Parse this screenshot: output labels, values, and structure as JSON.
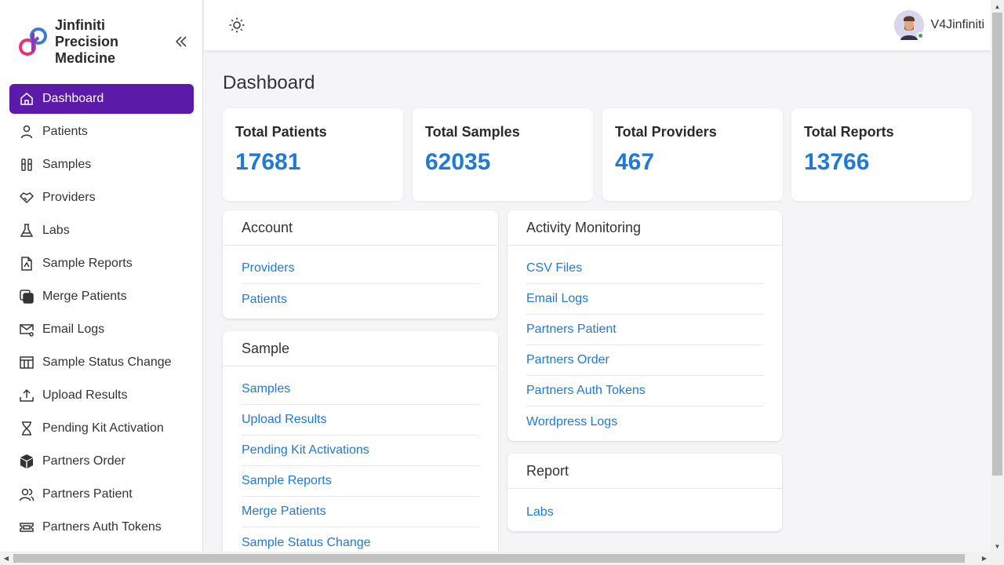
{
  "brand": {
    "name": "Jinfiniti Precision Medicine"
  },
  "sidebar": {
    "items": [
      {
        "label": "Dashboard",
        "icon": "home-icon",
        "active": true
      },
      {
        "label": "Patients",
        "icon": "user-icon"
      },
      {
        "label": "Samples",
        "icon": "test-tubes-icon"
      },
      {
        "label": "Providers",
        "icon": "handshake-icon"
      },
      {
        "label": "Labs",
        "icon": "flask-icon"
      },
      {
        "label": "Sample Reports",
        "icon": "pdf-report-icon"
      },
      {
        "label": "Merge Patients",
        "icon": "merge-icon"
      },
      {
        "label": "Email Logs",
        "icon": "mail-settings-icon"
      },
      {
        "label": "Sample Status Change",
        "icon": "table-icon"
      },
      {
        "label": "Upload Results",
        "icon": "upload-icon"
      },
      {
        "label": "Pending Kit Activation",
        "icon": "hourglass-icon"
      },
      {
        "label": "Partners Order",
        "icon": "box-icon"
      },
      {
        "label": "Partners Patient",
        "icon": "users-icon"
      },
      {
        "label": "Partners Auth Tokens",
        "icon": "ticket-icon"
      }
    ]
  },
  "topbar": {
    "username": "V4Jinfiniti",
    "status_color": "#2bb24c"
  },
  "main": {
    "title": "Dashboard",
    "stats": [
      {
        "label": "Total Patients",
        "value": "17681"
      },
      {
        "label": "Total Samples",
        "value": "62035"
      },
      {
        "label": "Total Providers",
        "value": "467"
      },
      {
        "label": "Total Reports",
        "value": "13766"
      }
    ],
    "panels": {
      "account": {
        "title": "Account",
        "links": [
          "Providers",
          "Patients"
        ]
      },
      "sample": {
        "title": "Sample",
        "links": [
          "Samples",
          "Upload Results",
          "Pending Kit Activations",
          "Sample Reports",
          "Merge Patients",
          "Sample Status Change"
        ]
      },
      "activity": {
        "title": "Activity Monitoring",
        "links": [
          "CSV Files",
          "Email Logs",
          "Partners Patient",
          "Partners Order",
          "Partners Auth Tokens",
          "Wordpress Logs"
        ]
      },
      "report": {
        "title": "Report",
        "links": [
          "Labs"
        ]
      }
    }
  },
  "colors": {
    "accent": "#5b1aa8",
    "link": "#1e7ad4"
  }
}
